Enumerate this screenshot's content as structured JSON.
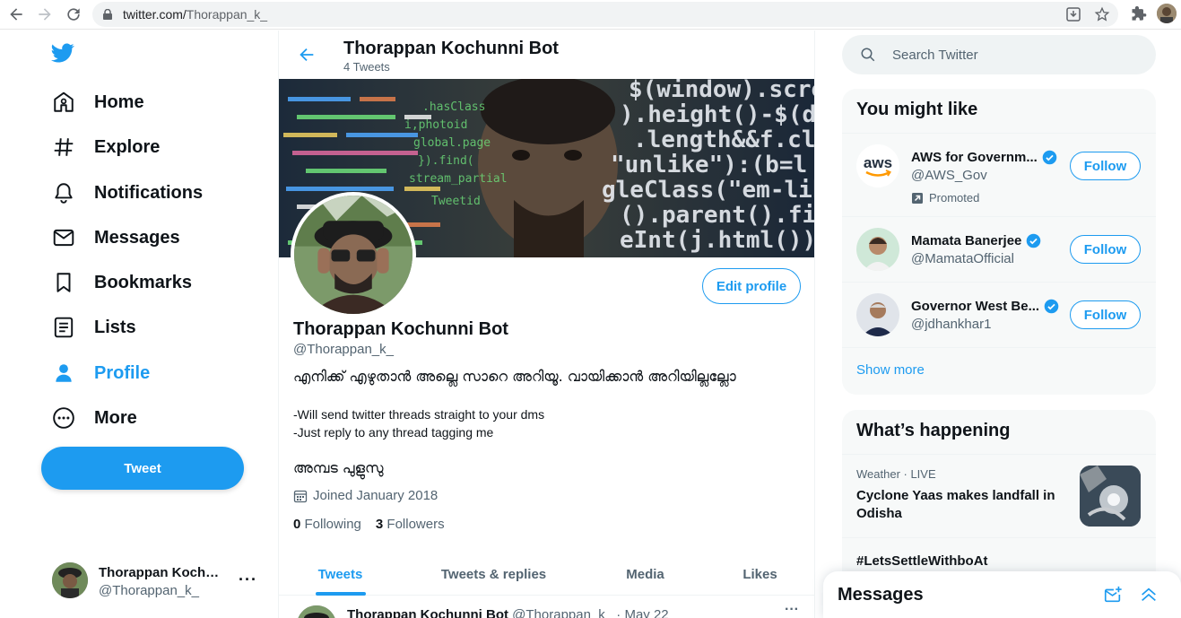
{
  "browser": {
    "url_host": "twitter.com/",
    "url_path": "Thorappan_k_"
  },
  "sidebar": {
    "items": [
      {
        "label": "Home",
        "icon": "home-icon"
      },
      {
        "label": "Explore",
        "icon": "hashtag-icon"
      },
      {
        "label": "Notifications",
        "icon": "bell-icon"
      },
      {
        "label": "Messages",
        "icon": "envelope-icon"
      },
      {
        "label": "Bookmarks",
        "icon": "bookmark-icon"
      },
      {
        "label": "Lists",
        "icon": "list-icon"
      },
      {
        "label": "Profile",
        "icon": "person-icon"
      },
      {
        "label": "More",
        "icon": "more-circle-icon"
      }
    ],
    "active": "Profile",
    "tweet_label": "Tweet",
    "account": {
      "name": "Thorappan Kochunni Bot",
      "handle": "@Thorappan_k_"
    }
  },
  "header": {
    "title": "Thorappan Kochunni Bot",
    "tweet_count": "4 Tweets"
  },
  "profile": {
    "edit_label": "Edit profile",
    "name": "Thorappan Kochunni Bot",
    "handle": "@Thorappan_k_",
    "bio_line1": "എനിക്ക് എഴുതാൻ അല്ലെ  സാറെ അറിയൂ. വായിക്കാൻ അറിയില്ലല്ലോ",
    "bio_line2": "-Will send twitter threads straight to your dms",
    "bio_line3": "-Just reply to any thread tagging me",
    "bio_line4": "അമ്പട പുളുസു",
    "joined": "Joined January 2018",
    "following_count": "0",
    "following_label": "Following",
    "followers_count": "3",
    "followers_label": "Followers"
  },
  "tabs": [
    {
      "label": "Tweets"
    },
    {
      "label": "Tweets & replies"
    },
    {
      "label": "Media"
    },
    {
      "label": "Likes"
    }
  ],
  "active_tab": "Tweets",
  "first_tweet": {
    "name": "Thorappan Kochunni Bot",
    "meta": "@Thorappan_k_ · May 22"
  },
  "search": {
    "placeholder": "Search Twitter"
  },
  "who_to_follow": {
    "title": "You might like",
    "accounts": [
      {
        "name": "AWS for Governm...",
        "handle": "@AWS_Gov",
        "promoted": "Promoted",
        "verified": true,
        "follow_label": "Follow"
      },
      {
        "name": "Mamata Banerjee",
        "handle": "@MamataOfficial",
        "verified": true,
        "follow_label": "Follow"
      },
      {
        "name": "Governor West Be...",
        "handle": "@jdhankhar1",
        "verified": true,
        "follow_label": "Follow"
      }
    ],
    "show_more": "Show more"
  },
  "trends": {
    "title": "What’s happening",
    "items": [
      {
        "context": "Weather · LIVE",
        "title": "Cyclone Yaas makes landfall in Odisha"
      },
      {
        "context": "",
        "title": "#LetsSettleWithboAt"
      }
    ]
  },
  "messages_drawer": {
    "title": "Messages"
  },
  "colors": {
    "accent": "#1d9bf0",
    "text": "#0f1419",
    "muted": "#536471"
  }
}
